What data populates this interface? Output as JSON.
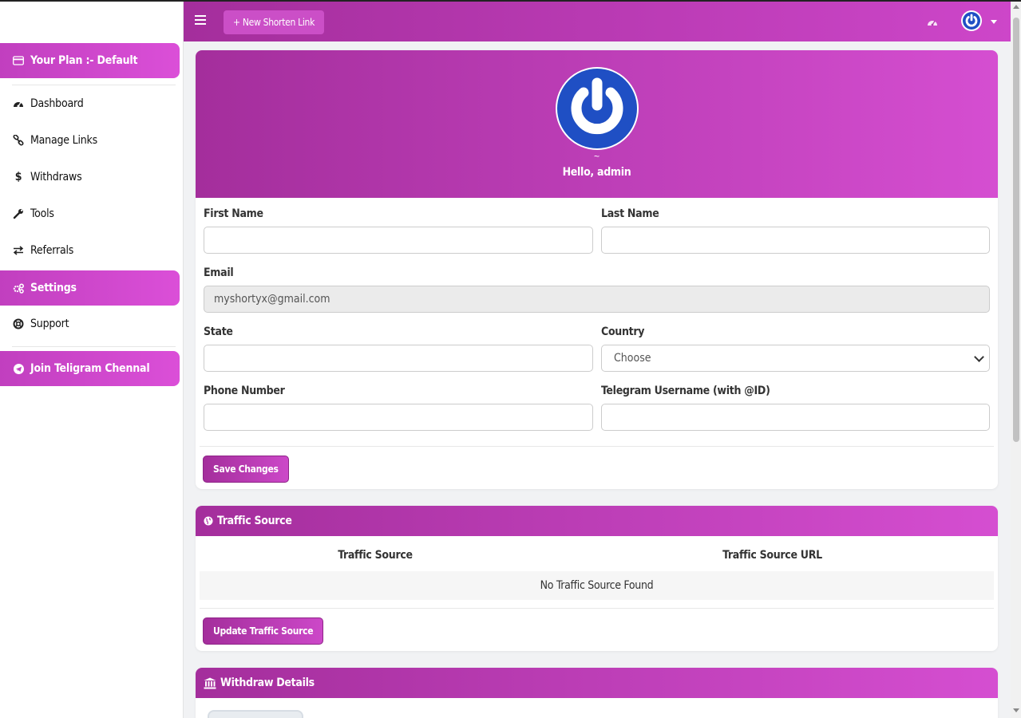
{
  "sidebar": {
    "plan": "Your Plan :- Default",
    "items": [
      {
        "label": "Dashboard"
      },
      {
        "label": "Manage Links"
      },
      {
        "label": "Withdraws"
      },
      {
        "label": "Tools"
      },
      {
        "label": "Referrals"
      },
      {
        "label": "Settings"
      },
      {
        "label": "Support"
      }
    ],
    "telegram": "Join Teligram Chennal"
  },
  "topbar": {
    "new_link": "+ New Shorten Link"
  },
  "profile": {
    "tilde": "~",
    "greeting": "Hello, admin",
    "first_name_label": "First Name",
    "first_name_value": "",
    "last_name_label": "Last Name",
    "last_name_value": "",
    "email_label": "Email",
    "email_value": "myshortyx@gmail.com",
    "state_label": "State",
    "state_value": "",
    "country_label": "Country",
    "country_value": "Choose",
    "phone_label": "Phone Number",
    "phone_value": "",
    "telegram_label": "Telegram Username (with @ID)",
    "telegram_value": "",
    "save_button": "Save Changes"
  },
  "traffic": {
    "title": "Traffic Source",
    "col_source": "Traffic Source",
    "col_url": "Traffic Source URL",
    "empty": "No Traffic Source Found",
    "update_button": "Update Traffic Source"
  },
  "withdraw": {
    "title": "Withdraw Details"
  },
  "colors": {
    "accent": "#c13fbf",
    "accent_dark": "#a42e9c",
    "avatar_blue": "#1f4fc4"
  }
}
